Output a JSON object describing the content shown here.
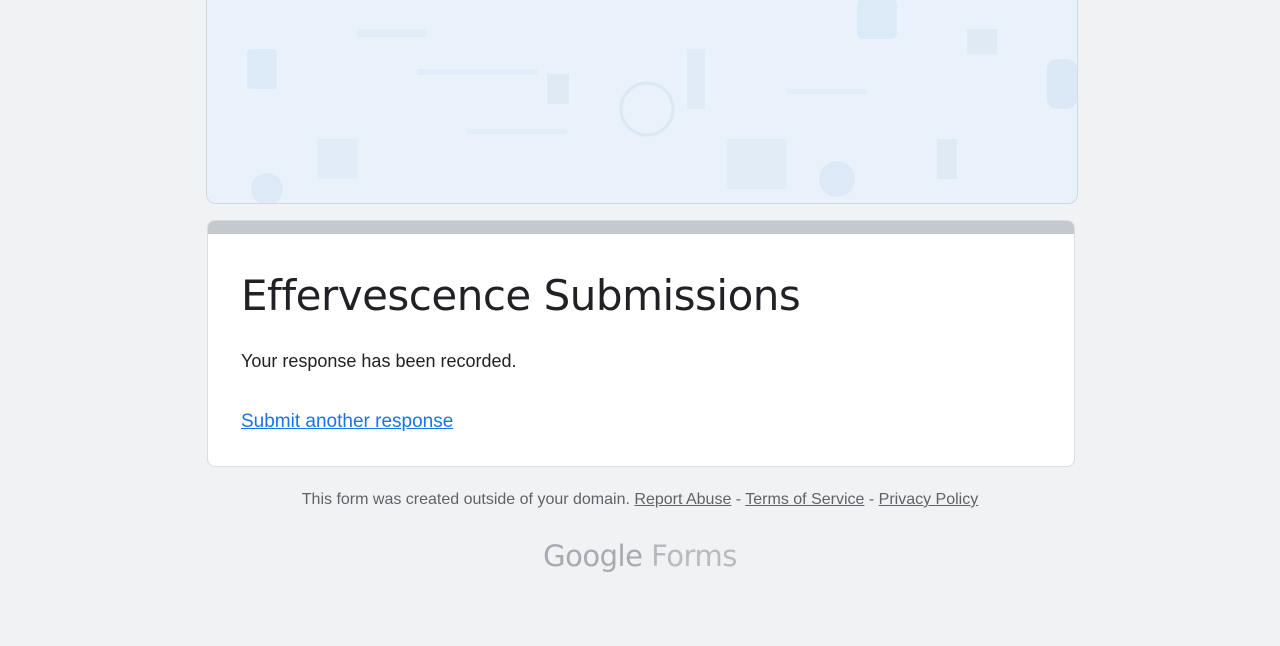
{
  "form": {
    "title": "Effervescence Submissions",
    "confirmation_message": "Your response has been recorded.",
    "submit_another_link": "Submit another response"
  },
  "footer": {
    "notice": "This form was created outside of your domain.",
    "report_abuse": "Report Abuse",
    "separator": " - ",
    "terms": "Terms of Service",
    "privacy": "Privacy Policy"
  },
  "brand": {
    "google": "Google",
    "forms": "Forms"
  },
  "colors": {
    "background": "#f1f2f4",
    "card_top_bar": "#c3c9cd",
    "link": "#1a73e8",
    "header_image_tint": "#e9f1fb"
  }
}
